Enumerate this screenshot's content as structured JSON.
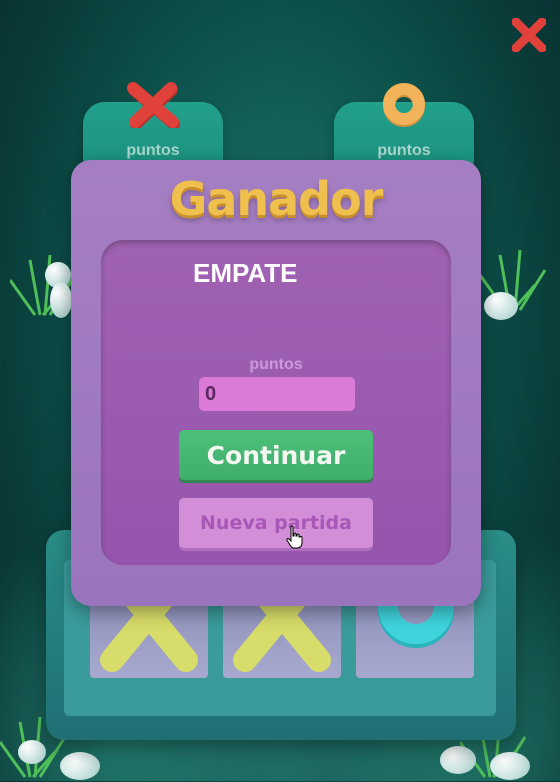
{
  "scores": {
    "player_x_label": "puntos",
    "player_o_label": "puntos"
  },
  "modal": {
    "title": "Ganador",
    "result": "EMPATE",
    "points_label": "puntos",
    "points_value": "0",
    "continue_label": "Continuar",
    "new_game_label": "Nueva partida"
  },
  "board": {
    "cells": [
      "X",
      "X",
      "O"
    ]
  },
  "colors": {
    "x_red": "#e0413a",
    "o_orange": "#f2b35a",
    "x_yellow": "#d8dc6a",
    "o_cyan": "#3fd4dc",
    "title_gold": "#efc04e",
    "continue_green": "#4cc07a"
  },
  "icons": {
    "close": "close-x-icon",
    "player_x": "red-x-icon",
    "player_o": "orange-o-icon",
    "cursor": "hand-pointer-icon"
  }
}
